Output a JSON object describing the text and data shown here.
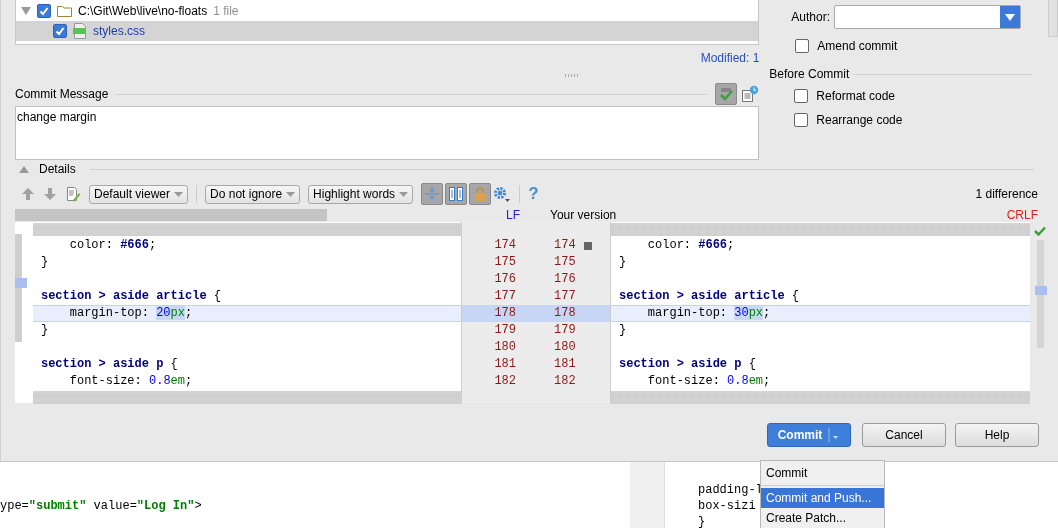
{
  "changes_tree": [
    {
      "label": "C:\\Git\\Web\\live\\no-floats",
      "count": "1 file",
      "checked": true,
      "selected": false,
      "kind": "folder"
    },
    {
      "label": "styles.css",
      "checked": true,
      "selected": true,
      "kind": "file"
    }
  ],
  "modified": "Modified: 1",
  "commit_message": {
    "label": "Commit Message",
    "value": "change margin",
    "spellcheck_on": true
  },
  "author": {
    "label": "Author:"
  },
  "amend": {
    "label": "Amend commit",
    "checked": false
  },
  "before_commit": {
    "title": "Before Commit",
    "options": [
      {
        "label": "Reformat code",
        "checked": false
      },
      {
        "label": "Rearrange code",
        "checked": false
      }
    ]
  },
  "details": {
    "title": "Details",
    "expanded": true
  },
  "toolbar": {
    "dropdowns": [
      "Default viewer",
      "Do not ignore",
      "Highlight words"
    ],
    "toggles": [
      {
        "kind": "sync",
        "selected": true
      },
      {
        "kind": "sidebyside",
        "selected": true
      },
      {
        "kind": "lock",
        "selected": true
      }
    ],
    "help": "?",
    "differences": "1 difference"
  },
  "diff": {
    "left_separator": "LF",
    "right_title": "Your version",
    "right_separator": "CRLF",
    "rows": [
      {
        "left_no": "174",
        "right_no": "174",
        "changed": false,
        "left": [
          {
            "t": "    color: ",
            "kind": "prop"
          },
          {
            "t": "#666",
            "kind": "hex"
          },
          {
            "t": ";",
            "kind": "prop"
          }
        ],
        "right": [
          {
            "t": "    color: ",
            "kind": "prop"
          },
          {
            "t": "#666",
            "kind": "hex"
          },
          {
            "t": ";",
            "kind": "prop"
          }
        ]
      },
      {
        "left_no": "175",
        "right_no": "175",
        "changed": false,
        "left": [
          {
            "t": "}",
            "kind": "punct"
          }
        ],
        "right": [
          {
            "t": "}",
            "kind": "punct"
          }
        ]
      },
      {
        "left_no": "176",
        "right_no": "176",
        "changed": false
      },
      {
        "left_no": "177",
        "right_no": "177",
        "changed": false,
        "left": [
          {
            "t": "section > aside article",
            "kind": "selector"
          },
          {
            "t": " {",
            "kind": "punct"
          }
        ],
        "right": [
          {
            "t": "section > aside article",
            "kind": "selector"
          },
          {
            "t": " {",
            "kind": "punct"
          }
        ]
      },
      {
        "left_no": "178",
        "right_no": "178",
        "changed": true,
        "left": [
          {
            "t": "    margin-top: ",
            "kind": "prop"
          },
          {
            "t": "20",
            "kind": "num",
            "word_changed": true
          },
          {
            "t": "px",
            "kind": "unit",
            "word_changed": true
          },
          {
            "t": ";",
            "kind": "prop"
          }
        ],
        "right": [
          {
            "t": "    margin-top: ",
            "kind": "prop"
          },
          {
            "t": "30",
            "kind": "num",
            "word_changed": true
          },
          {
            "t": "px",
            "kind": "unit",
            "word_changed": true
          },
          {
            "t": ";",
            "kind": "prop"
          }
        ]
      },
      {
        "left_no": "179",
        "right_no": "179",
        "changed": false,
        "left": [
          {
            "t": "}",
            "kind": "punct"
          }
        ],
        "right": [
          {
            "t": "}",
            "kind": "punct"
          }
        ]
      },
      {
        "left_no": "180",
        "right_no": "180",
        "changed": false
      },
      {
        "left_no": "181",
        "right_no": "181",
        "changed": false,
        "left": [
          {
            "t": "section > aside p",
            "kind": "selector"
          },
          {
            "t": " {",
            "kind": "punct"
          }
        ],
        "right": [
          {
            "t": "section > aside p",
            "kind": "selector"
          },
          {
            "t": " {",
            "kind": "punct"
          }
        ]
      },
      {
        "left_no": "182",
        "right_no": "182",
        "changed": false,
        "left": [
          {
            "t": "    font-size: ",
            "kind": "prop"
          },
          {
            "t": "0.8",
            "kind": "num"
          },
          {
            "t": "em",
            "kind": "unit"
          },
          {
            "t": ";",
            "kind": "prop"
          }
        ],
        "right": [
          {
            "t": "    font-size: ",
            "kind": "prop"
          },
          {
            "t": "0.8",
            "kind": "num"
          },
          {
            "t": "em",
            "kind": "unit"
          },
          {
            "t": ";",
            "kind": "prop"
          }
        ]
      }
    ]
  },
  "buttons": [
    {
      "label": "Commit",
      "kind": "default"
    },
    {
      "label": "Cancel",
      "kind": "normal"
    },
    {
      "label": "Help",
      "kind": "normal"
    }
  ],
  "background_editor": {
    "left_line": [
      {
        "t": "ype=",
        "kind": "prop"
      },
      {
        "t": "\"submit\"",
        "kind": "str"
      },
      {
        "t": " value=",
        "kind": "prop"
      },
      {
        "t": "\"Log In\"",
        "kind": "str"
      },
      {
        "t": ">",
        "kind": "prop"
      }
    ],
    "right_lines": [
      "padding-l",
      "box-sizi",
      "}"
    ]
  },
  "commit_menu": [
    {
      "label": "Commit",
      "selected": false
    },
    {
      "label": "Commit and Push...",
      "selected": true
    },
    {
      "label": "Create Patch...",
      "selected": false
    }
  ]
}
